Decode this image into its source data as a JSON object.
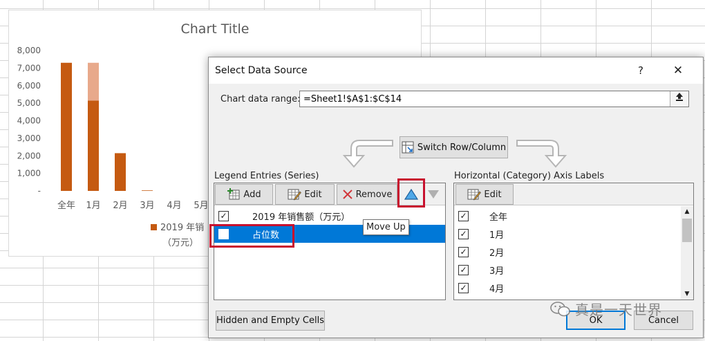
{
  "chart": {
    "title": "Chart Title",
    "legend_line1": "2019 年销",
    "legend_line2": "（万元）",
    "series_color": "#c55a11",
    "series_color_light": "#e8a98b"
  },
  "chart_data": {
    "type": "bar",
    "title": "Chart Title",
    "categories": [
      "全年",
      "1月",
      "2月",
      "3月",
      "4月",
      "5月"
    ],
    "series": [
      {
        "name": "2019 年销售额（万元）",
        "values": [
          7300,
          5150,
          2150,
          30,
          0,
          0
        ]
      },
      {
        "name": "占位数",
        "values": [
          0,
          2150,
          0,
          0,
          0,
          0
        ]
      }
    ],
    "stacked": true,
    "ylim": [
      0,
      8000
    ],
    "yticks": [
      "-",
      "1,000",
      "2,000",
      "3,000",
      "4,000",
      "5,000",
      "6,000",
      "7,000",
      "8,000"
    ]
  },
  "dialog": {
    "title": "Select Data Source",
    "help": "?",
    "close": "✕",
    "range_label": "Chart data range:",
    "range_value": "=Sheet1!$A$1:$C$14",
    "switch_label": "Switch Row/Column",
    "legend_label": "Legend Entries (Series)",
    "axis_label": "Horizontal (Category) Axis Labels",
    "add": "Add",
    "edit": "Edit",
    "remove": "Remove",
    "axis_edit": "Edit",
    "series": [
      {
        "label": "2019 年销售额（万元）",
        "checked": true
      },
      {
        "label": "占位数",
        "checked": true
      }
    ],
    "axis_items": [
      {
        "label": "全年",
        "checked": true
      },
      {
        "label": "1月",
        "checked": true
      },
      {
        "label": "2月",
        "checked": true
      },
      {
        "label": "3月",
        "checked": true
      },
      {
        "label": "4月",
        "checked": true
      }
    ],
    "tooltip": "Move Up",
    "hidden_cells": "Hidden and Empty Cells",
    "ok": "OK",
    "cancel": "Cancel",
    "check_mark": "✓"
  },
  "watermark": "真是一天世界",
  "highlight_color": "#c8102e",
  "accent_color": "#0078d7"
}
